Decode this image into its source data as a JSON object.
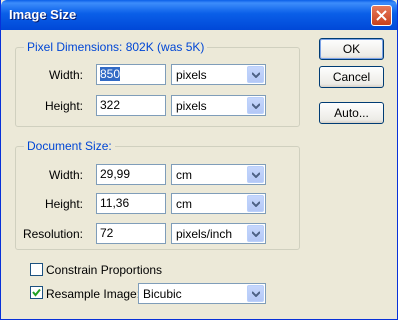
{
  "window": {
    "title": "Image Size"
  },
  "pixel_dimensions": {
    "legend": "Pixel Dimensions:  802K (was 5K)",
    "width": {
      "label": "Width:",
      "value": "850",
      "unit": "pixels"
    },
    "height": {
      "label": "Height:",
      "value": "322",
      "unit": "pixels"
    }
  },
  "document_size": {
    "legend": "Document Size:",
    "width": {
      "label": "Width:",
      "value": "29,99",
      "unit": "cm"
    },
    "height": {
      "label": "Height:",
      "value": "11,36",
      "unit": "cm"
    },
    "resolution": {
      "label": "Resolution:",
      "value": "72",
      "unit": "pixels/inch"
    }
  },
  "options": {
    "constrain": {
      "label": "Constrain Proportions",
      "checked": false
    },
    "resample": {
      "label": "Resample Image:",
      "checked": true,
      "method": "Bicubic"
    }
  },
  "buttons": {
    "ok": "OK",
    "cancel": "Cancel",
    "auto": "Auto..."
  },
  "colors": {
    "title_bar": "#0a5fe8",
    "legend": "#0046d5",
    "selection": "#316ac5"
  }
}
